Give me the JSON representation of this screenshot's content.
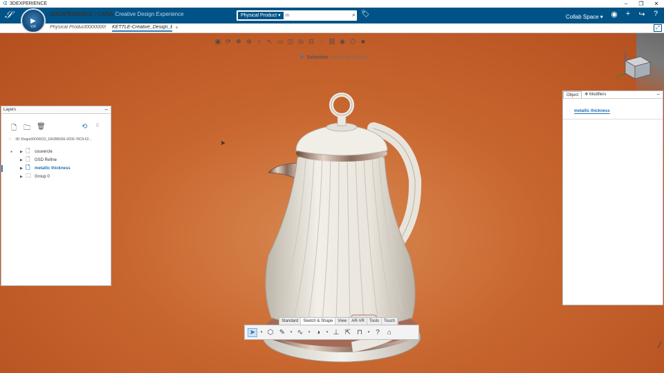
{
  "os_window": {
    "title": "3DEXPERIENCE",
    "minimize": "–",
    "restore": "❐",
    "close": "✕"
  },
  "header": {
    "brand_main": "3DEXPERIENCE",
    "brand_sep": " | ",
    "brand_app": "CATIA",
    "brand_role": " Creative Design Experience",
    "compass_label": "V,R",
    "search": {
      "category": "Physical Product ▾",
      "placeholder": "m"
    },
    "collab_space": "Collab Space ▾"
  },
  "tabs": {
    "tab1": "Physical Product0000000!",
    "tab2": "KETTLE-Creative_Design_Ex",
    "add": "+"
  },
  "viewport": {
    "selection_label": "Selection",
    "selection_hint": "Select an Object"
  },
  "layers_panel": {
    "title": "Layers",
    "shape_name": "3D Shape00000032_DA2BB30E-0000-78C8-62...",
    "items": [
      {
        "label": "couvercle"
      },
      {
        "label": "GSD Refine"
      },
      {
        "label": "metallic thickness"
      },
      {
        "label": "Group 0"
      }
    ]
  },
  "object_panel": {
    "tab_object": "Object",
    "tab_modifiers": "Modifiers",
    "object_name": "metallic thickness"
  },
  "section_tabs": [
    "Standard",
    "Sketch & Shape",
    "View",
    "AR-VR",
    "Tools",
    "Touch"
  ],
  "icons": {
    "search": "search-icon",
    "tag": "tag-icon",
    "user": "user-icon",
    "add": "plus-icon",
    "share": "share-icon",
    "help": "help-icon"
  },
  "colors": {
    "header": "#005386",
    "accent": "#2b7bbf",
    "background": "#c4602a"
  }
}
